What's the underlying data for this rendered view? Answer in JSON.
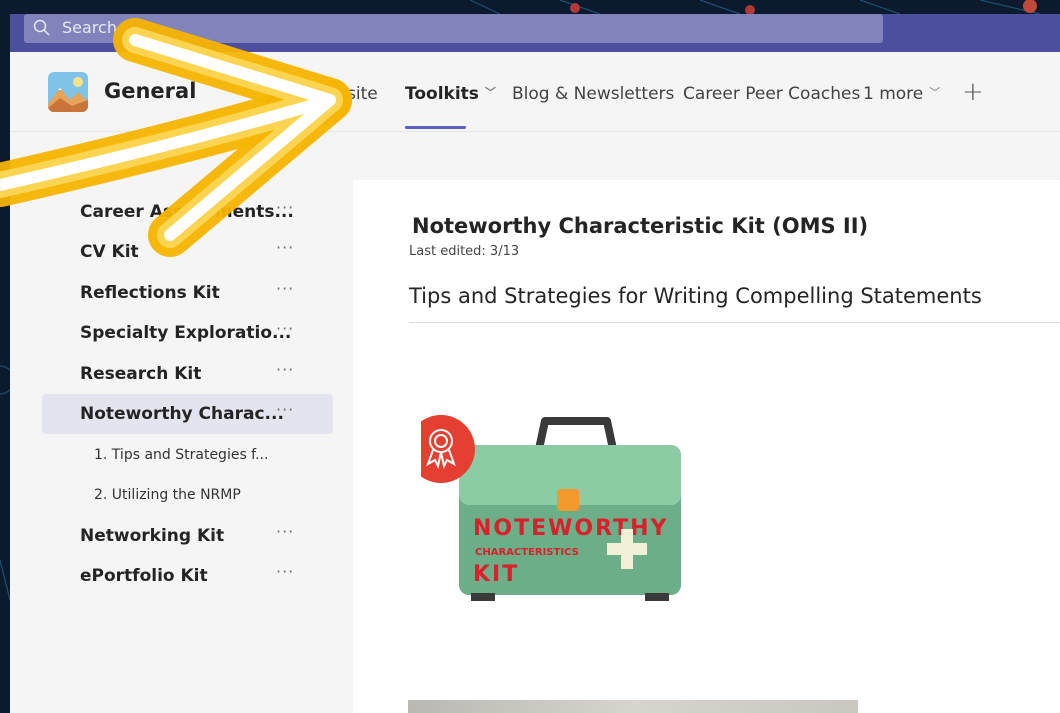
{
  "search": {
    "placeholder": "Search"
  },
  "header": {
    "channel_name": "General",
    "tabs": [
      {
        "label": "Website"
      },
      {
        "label": "Toolkits"
      },
      {
        "label": "Blog & Newsletters"
      },
      {
        "label": "Career Peer Coaches"
      },
      {
        "label": "1 more"
      }
    ]
  },
  "sidebar": {
    "items": [
      {
        "label": "Career Assessments...",
        "more": "···"
      },
      {
        "label": "CV Kit",
        "more": "···"
      },
      {
        "label": "Reflections Kit",
        "more": "···"
      },
      {
        "label": "Specialty Exploratio...",
        "more": "···"
      },
      {
        "label": "Research Kit",
        "more": "···"
      },
      {
        "label": "Noteworthy Charac...",
        "more": "···"
      },
      {
        "label": "1. Tips and Strategies f..."
      },
      {
        "label": "2. Utilizing the NRMP"
      },
      {
        "label": "Networking Kit",
        "more": "···"
      },
      {
        "label": "ePortfolio Kit",
        "more": "···"
      }
    ]
  },
  "page": {
    "title": "Noteworthy Characteristic Kit (OMS II)",
    "last_edited": "Last edited: 3/13",
    "section_title": "Tips and Strategies for Writing Compelling Statements",
    "image_text": {
      "line1": "NOTEWORTHY",
      "line2": "CHARACTERISTICS",
      "line3": "KIT"
    }
  },
  "colors": {
    "accent": "#5b5fc7",
    "title_bar": "#4b4f9e",
    "arrow": "#f5b400"
  }
}
